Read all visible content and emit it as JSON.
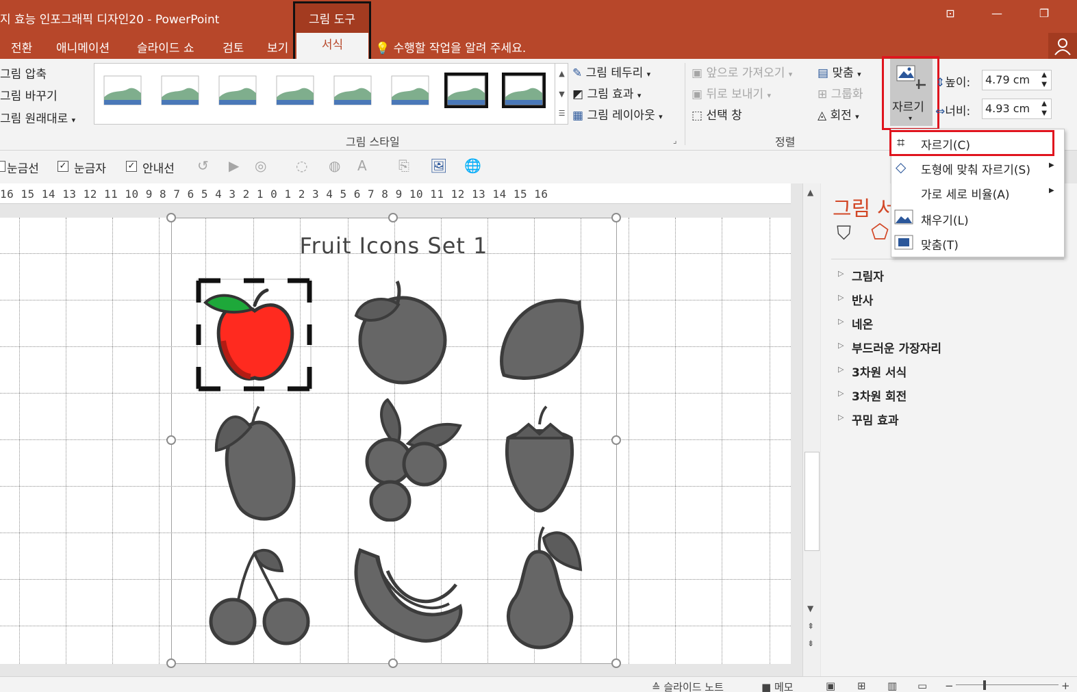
{
  "window": {
    "title": "지 효능 인포그래픽 디자인20 - PowerPoint",
    "context_group": "그림 도구",
    "accent": "#b7472a",
    "highlight": "#e0141e"
  },
  "tabs": [
    "전환",
    "애니메이션",
    "슬라이드 쇼",
    "검토",
    "보기"
  ],
  "active_tab": "서식",
  "tell_me": "수행할 작업을 알려 주세요.",
  "ribbon": {
    "adjust": [
      "그림 압축",
      "그림 바꾸기",
      "그림 원래대로"
    ],
    "style_menu": [
      "그림 테두리",
      "그림 효과",
      "그림 레이아웃"
    ],
    "style_group_label": "그림 스타일",
    "arrange": [
      "앞으로 가져오기",
      "뒤로 보내기",
      "선택 창"
    ],
    "arrange2": [
      "맞춤",
      "그룹화",
      "회전"
    ],
    "arrange_group_label": "정렬",
    "crop_label": "자르기",
    "height_label": "높이:",
    "height_value": "4.79 cm",
    "width_label": "너비:",
    "width_value": "4.93 cm"
  },
  "quickbar": {
    "gridlines": "눈금선",
    "ruler": "눈금자",
    "guides": "안내선"
  },
  "ruler_text": "16 15 14 13 12 11 10 9 8 7 6 5 4 3 2 1 0 1 2 3 4 5 6 7 8 9 10 11 12 13 14 15 16",
  "slide": {
    "title": "Fruit Icons Set  1"
  },
  "pane": {
    "title": "그림 서",
    "items": [
      "그림자",
      "반사",
      "네온",
      "부드러운 가장자리",
      "3차원 서식",
      "3차원 회전",
      "꾸밈 효과"
    ]
  },
  "crop_menu": {
    "items": [
      {
        "label": "자르기(C)",
        "icon": "crop-icon"
      },
      {
        "label": "도형에 맞춰 자르기(S)",
        "icon": "crop-shape-icon",
        "submenu": true
      },
      {
        "label": "가로 세로 비율(A)",
        "icon": "",
        "submenu": true
      },
      {
        "label": "채우기(L)",
        "icon": "fill-icon"
      },
      {
        "label": "맞춤(T)",
        "icon": "fit-icon"
      }
    ]
  },
  "status": {
    "notes": "슬라이드 노트",
    "comments": "메모"
  }
}
